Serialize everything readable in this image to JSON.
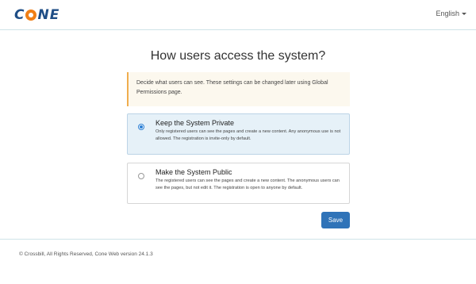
{
  "header": {
    "logo_letters": [
      "C",
      "N",
      "E"
    ],
    "logo_alt": "CONE",
    "language_label": "English"
  },
  "main": {
    "title": "How users access the system?",
    "notice": "Decide what users can see. These settings can be changed later using Global Permissions page.",
    "options": [
      {
        "title": "Keep the System Private",
        "description": "Only registered users can see the pages and create a new content. Any anonymous use is not allowed. The registration is invite-only by default.",
        "selected": true
      },
      {
        "title": "Make the System Public",
        "description": "The registered users can see the pages and create a new content. The anonymous users can see the pages, but not edit it. The registration is open to anyone by default.",
        "selected": false
      }
    ],
    "save_label": "Save"
  },
  "footer": {
    "text": "© Crossbill, All Rights Reserved, Cone Web version 24.1.3"
  },
  "colors": {
    "brand_blue": "#1f4e86",
    "brand_orange": "#f07f16",
    "accent_button": "#2f73b8",
    "notice_border": "#f0ad4e",
    "selected_bg": "#e6f1f8"
  }
}
